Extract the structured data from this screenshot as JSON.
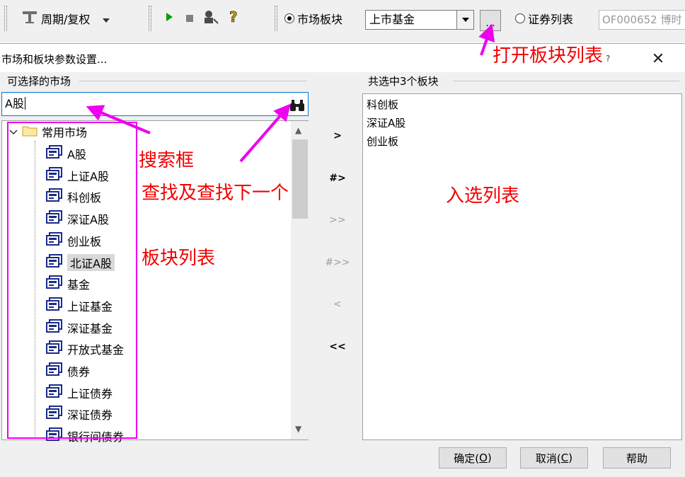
{
  "toolbar": {
    "cycle_label": "周期/复权",
    "market_radio_label": "市场板块",
    "market_combo_value": "上市基金",
    "dots_label": "...",
    "securities_radio_label": "证券列表",
    "code_field_value": "OF000652 博时"
  },
  "dialog": {
    "title": "市场和板块参数设置...",
    "close_label": "✕",
    "left_group_title": "可选择的市场",
    "search_value": "A股",
    "right_group_title": "共选中3个板块",
    "tree_root": "常用市场",
    "tree_items": [
      "A股",
      "上证A股",
      "科创板",
      "深证A股",
      "创业板",
      "北证A股",
      "基金",
      "上证基金",
      "深证基金",
      "开放式基金",
      "债券",
      "上证债券",
      "深证债券",
      "银行间债券"
    ],
    "selected_tree_item": "北证A股",
    "transfer_buttons": [
      ">",
      "#>",
      ">>",
      "#>>",
      "<",
      "<<"
    ],
    "selected_list": [
      "科创板",
      "深证A股",
      "创业板"
    ],
    "ok_button": "确定(O)",
    "cancel_button": "取消(C)",
    "help_button": "帮助"
  },
  "annotations": {
    "open_list": "打开板块列表",
    "search_box": "搜索框",
    "find_next": "查找及查找下一个",
    "selected_list": "入选列表",
    "sector_list": "板块列表"
  },
  "colors": {
    "annotation_text": "#f20000",
    "annotation_marker": "#ee00ee",
    "focus_border": "#0078d7"
  }
}
